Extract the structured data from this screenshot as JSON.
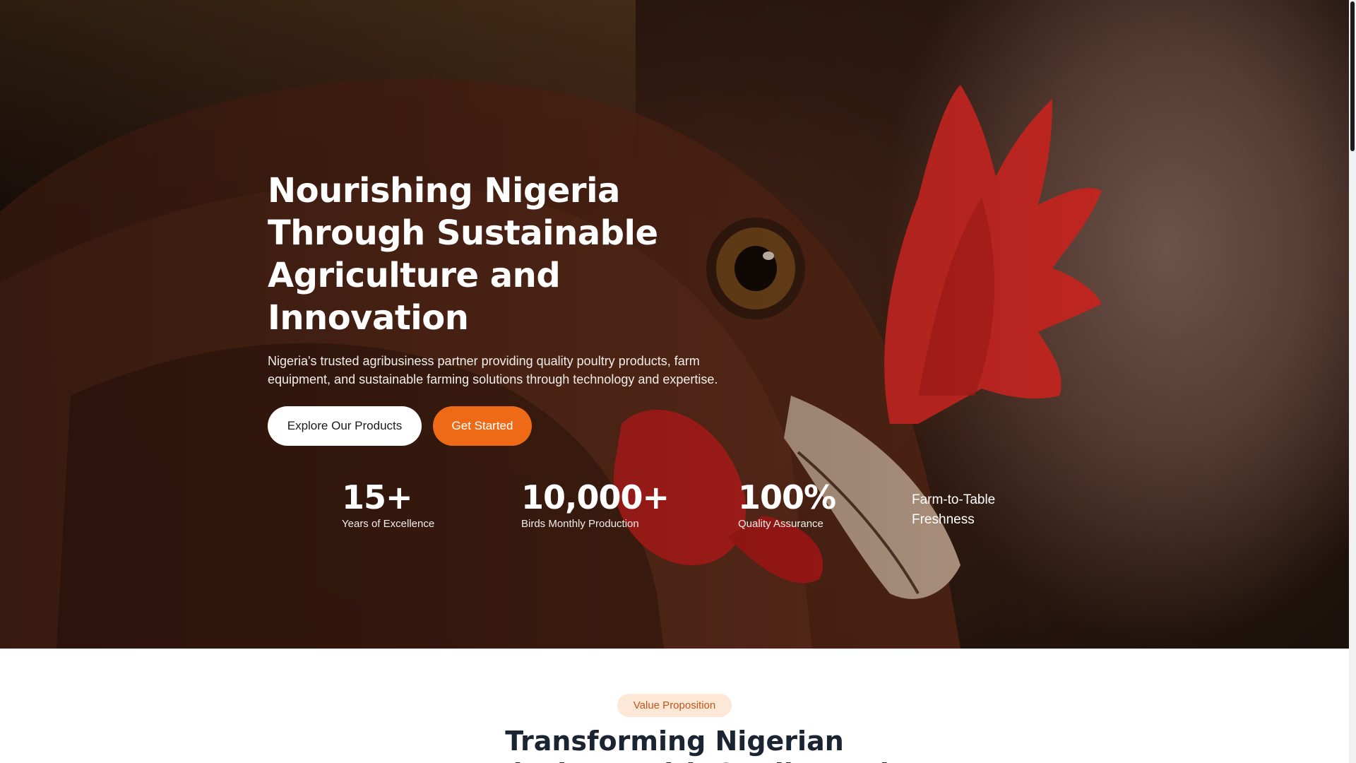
{
  "hero": {
    "title": "Nourishing Nigeria Through Sustainable Agriculture and Innovation",
    "subtitle": "Nigeria's trusted agribusiness partner providing quality poultry products, farm equipment, and sustainable farming solutions through technology and expertise.",
    "buttons": {
      "explore_label": "Explore Our Products",
      "get_started_label": "Get Started"
    },
    "background_image": "hen-closeup",
    "stats": [
      {
        "value": "15+",
        "label": "Years of Excellence"
      },
      {
        "value": "10,000+",
        "label": "Birds Monthly Production"
      },
      {
        "value": "100%",
        "label": "Quality Assurance"
      }
    ],
    "stat_text": "Farm-to-Table Freshness"
  },
  "value_section": {
    "badge": "Value Proposition",
    "title_line1": "Transforming Nigerian",
    "title_line2": "Agriculture with Quality and"
  },
  "colors": {
    "accent": "#ef6a16",
    "badge_bg": "#fde7d6",
    "badge_text": "#c2561a",
    "heading_dark": "#1b2433"
  }
}
